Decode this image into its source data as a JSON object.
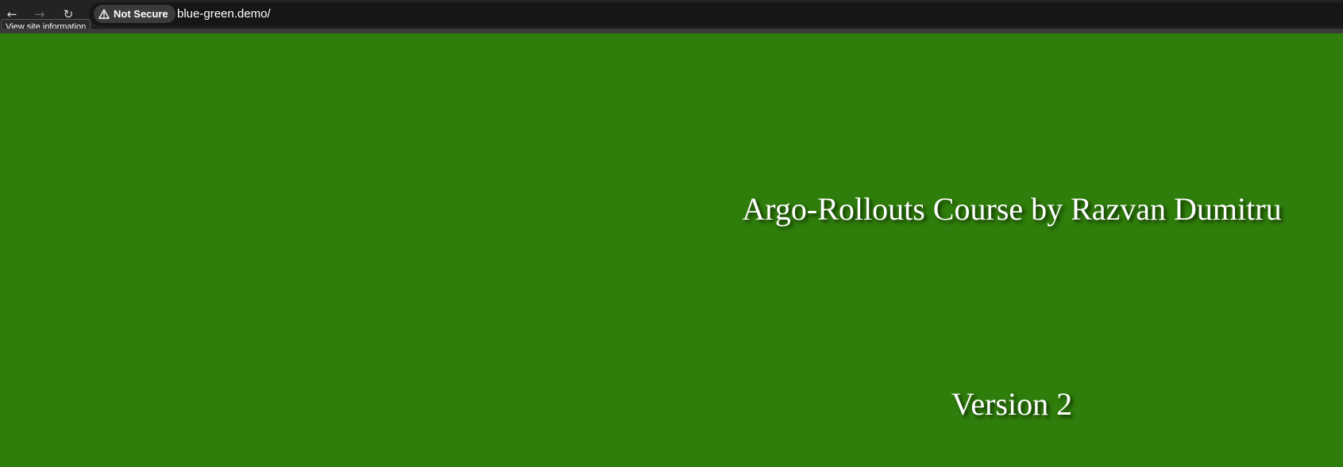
{
  "browser": {
    "back_icon_glyph": "←",
    "forward_icon_glyph": "→",
    "reload_icon_glyph": "↻",
    "security_label": "Not Secure",
    "url": "blue-green.demo/",
    "tooltip": "View site information",
    "icons": {
      "back": "back-arrow-icon",
      "forward": "forward-arrow-icon",
      "reload": "reload-icon",
      "warning": "warning-triangle-icon"
    }
  },
  "page": {
    "title": "Argo-Rollouts Course by Razvan Dumitru",
    "version": "Version 2",
    "background_color": "#2f7d0b",
    "text_color": "#ffffff"
  }
}
